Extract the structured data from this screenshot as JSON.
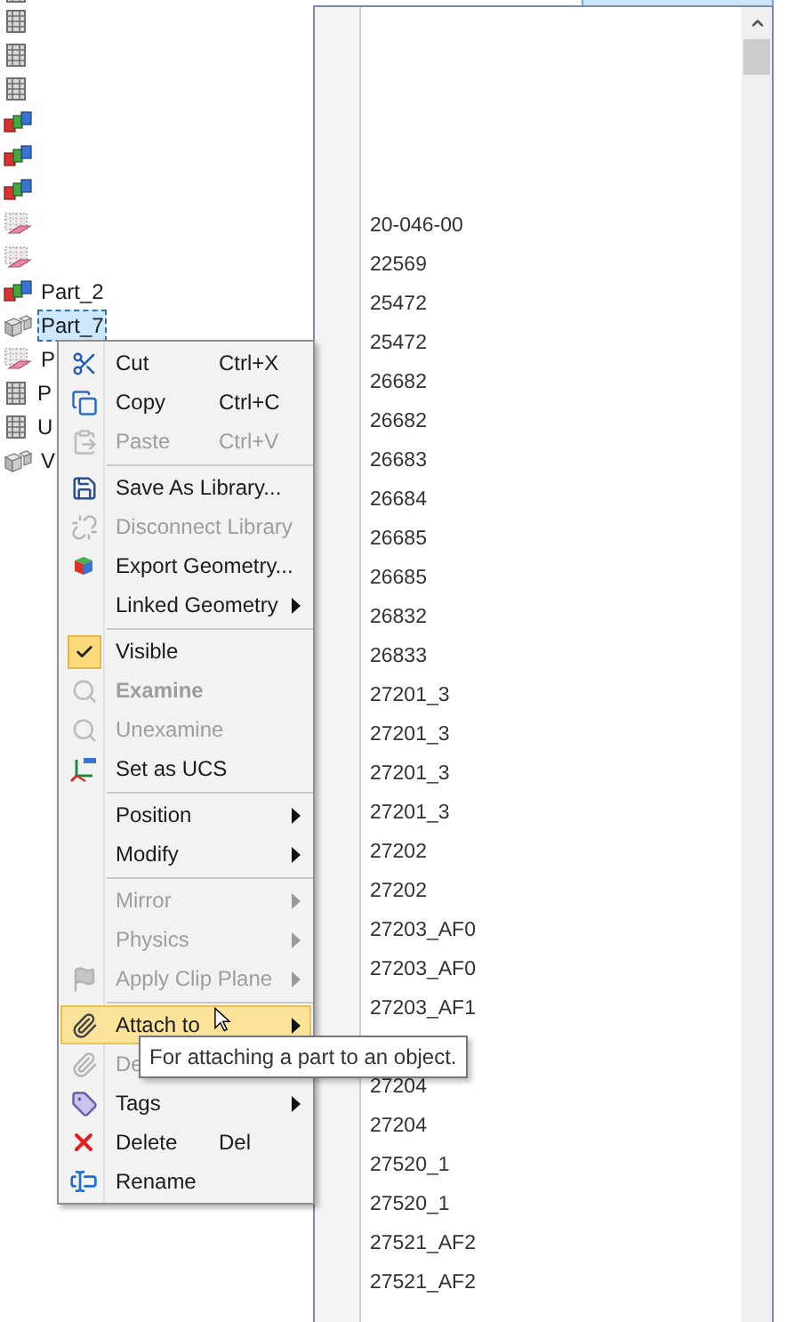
{
  "tree": {
    "items": [
      {
        "kind": "assembly",
        "selected": false
      },
      {
        "kind": "assembly",
        "selected": false
      },
      {
        "kind": "assembly",
        "selected": false
      },
      {
        "kind": "assembly",
        "selected": false
      },
      {
        "kind": "cubes",
        "selected": false
      },
      {
        "kind": "cubes",
        "selected": false
      },
      {
        "kind": "cubes",
        "selected": false
      },
      {
        "kind": "mesh",
        "selected": false
      },
      {
        "kind": "mesh",
        "selected": false
      },
      {
        "kind": "cubes",
        "label": "Part_2",
        "selected": false
      },
      {
        "kind": "part",
        "label": "Part_7",
        "selected": true
      },
      {
        "kind": "mesh",
        "label": "P",
        "selected": false
      },
      {
        "kind": "assembly",
        "label": "P",
        "selected": false
      },
      {
        "kind": "assembly",
        "label": "U",
        "selected": false
      },
      {
        "kind": "part",
        "label": "V",
        "selected": false
      }
    ]
  },
  "dropdown_list": {
    "items": [
      {
        "label": "20-046-00"
      },
      {
        "label": "22569"
      },
      {
        "label": "25472"
      },
      {
        "label": "25472"
      },
      {
        "label": "26682"
      },
      {
        "label": "26682"
      },
      {
        "label": "26683"
      },
      {
        "label": "26684"
      },
      {
        "label": "26685"
      },
      {
        "label": "26685"
      },
      {
        "label": "26832"
      },
      {
        "label": "26833"
      },
      {
        "label": "27201_3"
      },
      {
        "label": "27201_3"
      },
      {
        "label": "27201_3"
      },
      {
        "label": "27201_3"
      },
      {
        "label": "27202"
      },
      {
        "label": "27202"
      },
      {
        "label": "27203_AF0"
      },
      {
        "label": "27203_AF0"
      },
      {
        "label": "27203_AF1"
      },
      {
        "label": "27204",
        "after_gap": true
      },
      {
        "label": "27204"
      },
      {
        "label": "27520_1"
      },
      {
        "label": "27520_1"
      },
      {
        "label": "27521_AF2"
      },
      {
        "label": "27521_AF2"
      }
    ]
  },
  "context_menu": {
    "items": [
      {
        "kind": "scissors",
        "label": "Cut",
        "shortcut": "Ctrl+X",
        "disabled": false,
        "submenu": false,
        "selected": false
      },
      {
        "kind": "copy",
        "label": "Copy",
        "shortcut": "Ctrl+C",
        "disabled": false,
        "submenu": false,
        "selected": false
      },
      {
        "kind": "paste",
        "label": "Paste",
        "shortcut": "Ctrl+V",
        "disabled": true,
        "submenu": false,
        "selected": false
      },
      {
        "kind": "separator"
      },
      {
        "kind": "save",
        "label": "Save As Library...",
        "disabled": false,
        "submenu": false,
        "selected": false
      },
      {
        "kind": "disconnect",
        "label": "Disconnect Library",
        "disabled": true,
        "submenu": false,
        "selected": false
      },
      {
        "kind": "export",
        "label": "Export Geometry...",
        "disabled": false,
        "submenu": false,
        "selected": false
      },
      {
        "kind": "text",
        "label": "Linked Geometry",
        "disabled": false,
        "submenu": true,
        "selected": false
      },
      {
        "kind": "separator"
      },
      {
        "kind": "check",
        "label": "Visible",
        "checked": true,
        "disabled": false,
        "submenu": false,
        "selected": false
      },
      {
        "kind": "examine",
        "label": "Examine",
        "default": true,
        "disabled": true,
        "submenu": false,
        "selected": false
      },
      {
        "kind": "examine",
        "label": "Unexamine",
        "disabled": true,
        "submenu": false,
        "selected": false
      },
      {
        "kind": "ucs",
        "label": "Set as UCS",
        "disabled": false,
        "submenu": false,
        "selected": false
      },
      {
        "kind": "separator"
      },
      {
        "kind": "text",
        "label": "Position",
        "disabled": false,
        "submenu": true,
        "selected": false
      },
      {
        "kind": "text",
        "label": "Modify",
        "disabled": false,
        "submenu": true,
        "selected": false
      },
      {
        "kind": "separator"
      },
      {
        "kind": "text",
        "label": "Mirror",
        "disabled": true,
        "submenu": true,
        "selected": false
      },
      {
        "kind": "text",
        "label": "Physics",
        "disabled": true,
        "submenu": true,
        "selected": false
      },
      {
        "kind": "flag",
        "label": "Apply Clip Plane",
        "disabled": true,
        "submenu": true,
        "selected": false
      },
      {
        "kind": "separator"
      },
      {
        "kind": "paperclip",
        "label": "Attach to",
        "disabled": false,
        "submenu": true,
        "selected": true
      },
      {
        "kind": "detach",
        "label": "De",
        "disabled": true,
        "submenu": false,
        "selected": false
      },
      {
        "kind": "tag",
        "label": "Tags",
        "disabled": false,
        "submenu": true,
        "selected": false
      },
      {
        "kind": "delete",
        "label": "Delete",
        "shortcut": "Del",
        "disabled": false,
        "submenu": false,
        "selected": false
      },
      {
        "kind": "rename",
        "label": "Rename",
        "disabled": false,
        "submenu": false,
        "selected": false
      }
    ]
  },
  "tooltip": {
    "text": "For attaching a part to an object."
  }
}
